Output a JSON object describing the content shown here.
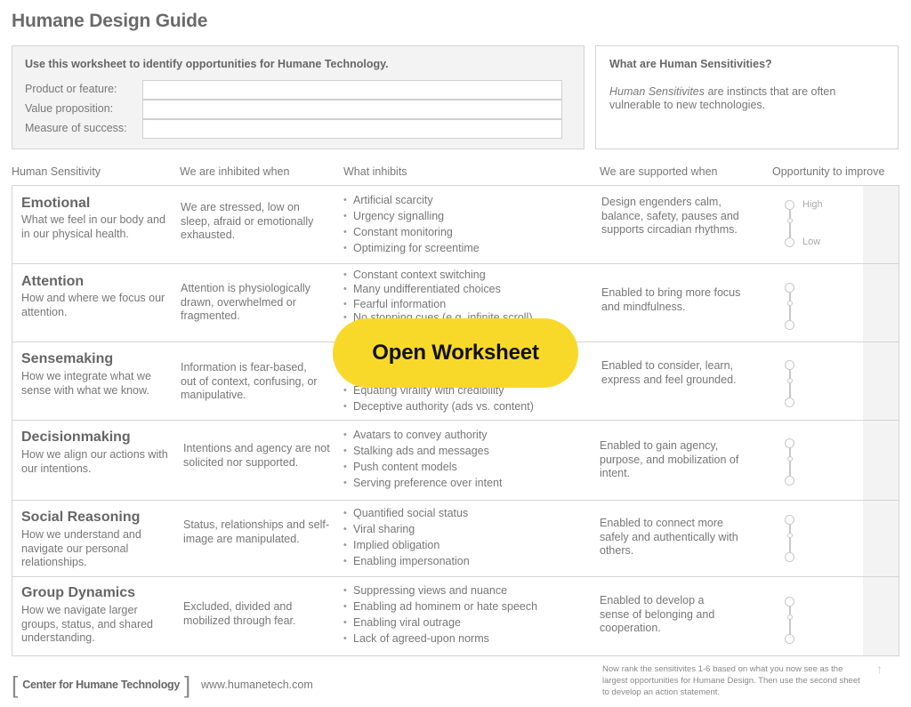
{
  "page": {
    "title": "Humane Design Guide"
  },
  "intro": {
    "heading": "Use this worksheet to identify opportunities for Humane Technology.",
    "fields": [
      {
        "label": "Product or feature:",
        "value": ""
      },
      {
        "label": "Value proposition:",
        "value": ""
      },
      {
        "label": "Measure of success:",
        "value": ""
      }
    ]
  },
  "info": {
    "title": "What are Human Sensitivities?",
    "term": "Human Sensitivites",
    "text": " are instincts that are often vulnerable to new technologies."
  },
  "columns": {
    "sensitivity": "Human Sensitivity",
    "inhibited": "We are inhibited when",
    "inhibits": "What inhibits",
    "supported": "We are supported when",
    "opportunity": "Opportunity to improve"
  },
  "rating_labels": {
    "high": "High",
    "low": "Low"
  },
  "rows": [
    {
      "name": "Emotional",
      "description": "What we feel in our body and in our physical health.",
      "inhibited": "We are stressed, low on sleep, afraid or emotionally exhausted.",
      "inhibits": [
        "Artificial scarcity",
        "Urgency signalling",
        "Constant monitoring",
        "Optimizing for screentime"
      ],
      "supported": "Design engenders calm, balance, safety, pauses and supports circadian rhythms."
    },
    {
      "name": "Attention",
      "description": "How and where we focus our attention.",
      "inhibited": "Attention is physiologically drawn, overwhelmed or fragmented.",
      "inhibits": [
        "Constant context switching",
        "Many undifferentiated choices",
        "Fearful information",
        "No stopping cues (e.g. infinite scroll)"
      ],
      "supported": "Enabled to bring more focus and mindfulness."
    },
    {
      "name": "Sensemaking",
      "description": "How we integrate what we sense with what we know.",
      "inhibited": "Information is fear-based, out of context, confusing, or manipulative.",
      "inhibits": [
        "Equating virality with credibility",
        "Deceptive authority (ads vs. content)"
      ],
      "supported": "Enabled to consider, learn, express and feel grounded."
    },
    {
      "name": "Decisionmaking",
      "description": "How we align our actions with our intentions.",
      "inhibited": "Intentions and agency are not solicited nor supported.",
      "inhibits": [
        "Avatars to convey authority",
        "Stalking ads and messages",
        "Push content models",
        "Serving preference over intent"
      ],
      "supported": "Enabled to gain agency, purpose, and mobilization of intent."
    },
    {
      "name": "Social Reasoning",
      "description": "How we understand and navigate our personal relationships.",
      "inhibited": "Status, relationships and self-image are manipulated.",
      "inhibits": [
        "Quantified social status",
        "Viral sharing",
        "Implied obligation",
        "Enabling impersonation"
      ],
      "supported": "Enabled to connect more safely and authentically with others."
    },
    {
      "name": "Group Dynamics",
      "description": "How we navigate larger groups, status, and shared understanding.",
      "inhibited": "Excluded, divided and mobilized through fear.",
      "inhibits": [
        "Suppressing views and nuance",
        "Enabling ad hominem or hate speech",
        "Enabling viral outrage",
        "Lack of agreed-upon norms"
      ],
      "supported": "Enabled to develop a sense of belonging and cooperation."
    }
  ],
  "cta": {
    "label": "Open Worksheet",
    "color": "#f8d92a"
  },
  "footer": {
    "org": "Center for Humane Technology",
    "url": "www.humanetech.com",
    "note": "Now rank the sensitivites 1-6 based on what you now see as the largest opportunities for Humane Design. Then use the second sheet to develop an action statement."
  }
}
